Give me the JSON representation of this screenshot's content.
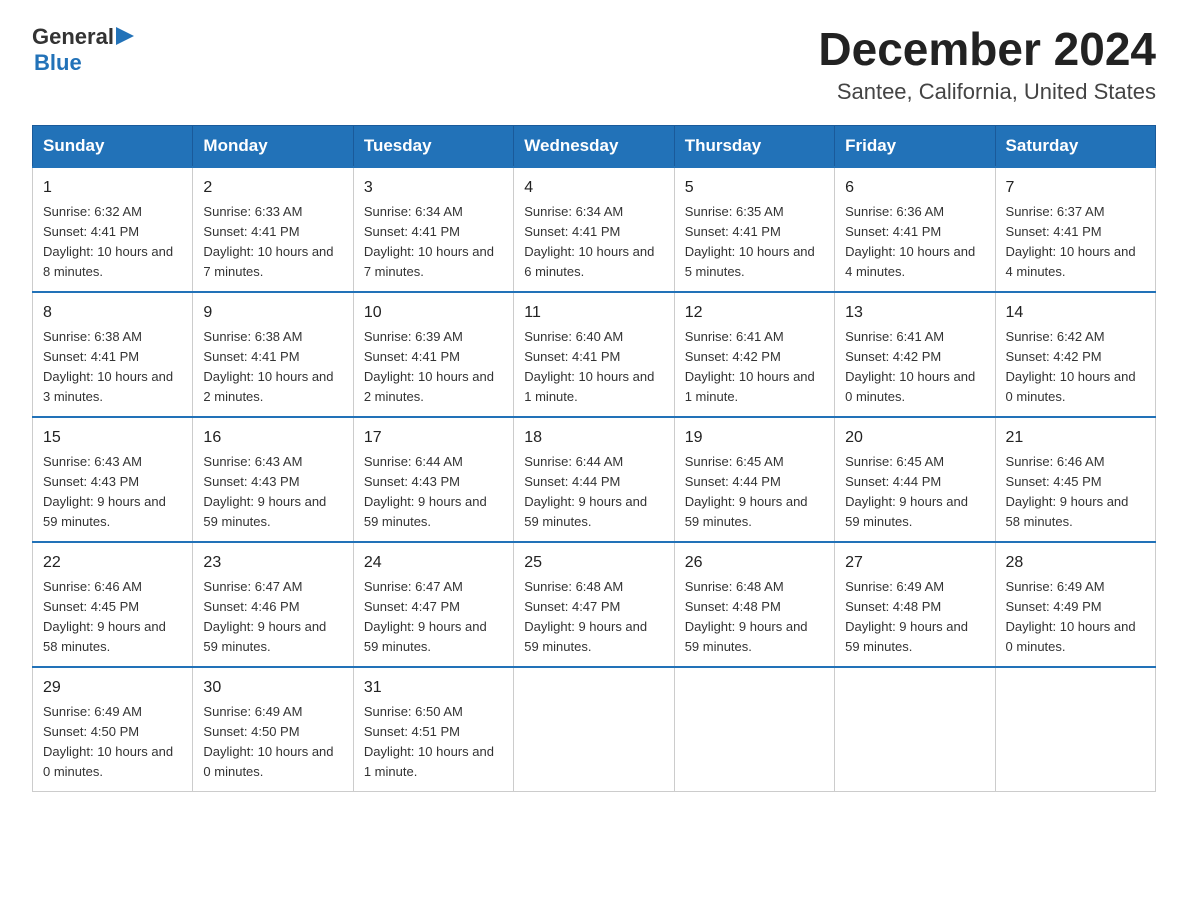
{
  "header": {
    "logo_general": "General",
    "logo_blue": "Blue",
    "title": "December 2024",
    "subtitle": "Santee, California, United States"
  },
  "days_of_week": [
    "Sunday",
    "Monday",
    "Tuesday",
    "Wednesday",
    "Thursday",
    "Friday",
    "Saturday"
  ],
  "weeks": [
    [
      {
        "day": "1",
        "sunrise": "6:32 AM",
        "sunset": "4:41 PM",
        "daylight": "10 hours and 8 minutes."
      },
      {
        "day": "2",
        "sunrise": "6:33 AM",
        "sunset": "4:41 PM",
        "daylight": "10 hours and 7 minutes."
      },
      {
        "day": "3",
        "sunrise": "6:34 AM",
        "sunset": "4:41 PM",
        "daylight": "10 hours and 7 minutes."
      },
      {
        "day": "4",
        "sunrise": "6:34 AM",
        "sunset": "4:41 PM",
        "daylight": "10 hours and 6 minutes."
      },
      {
        "day": "5",
        "sunrise": "6:35 AM",
        "sunset": "4:41 PM",
        "daylight": "10 hours and 5 minutes."
      },
      {
        "day": "6",
        "sunrise": "6:36 AM",
        "sunset": "4:41 PM",
        "daylight": "10 hours and 4 minutes."
      },
      {
        "day": "7",
        "sunrise": "6:37 AM",
        "sunset": "4:41 PM",
        "daylight": "10 hours and 4 minutes."
      }
    ],
    [
      {
        "day": "8",
        "sunrise": "6:38 AM",
        "sunset": "4:41 PM",
        "daylight": "10 hours and 3 minutes."
      },
      {
        "day": "9",
        "sunrise": "6:38 AM",
        "sunset": "4:41 PM",
        "daylight": "10 hours and 2 minutes."
      },
      {
        "day": "10",
        "sunrise": "6:39 AM",
        "sunset": "4:41 PM",
        "daylight": "10 hours and 2 minutes."
      },
      {
        "day": "11",
        "sunrise": "6:40 AM",
        "sunset": "4:41 PM",
        "daylight": "10 hours and 1 minute."
      },
      {
        "day": "12",
        "sunrise": "6:41 AM",
        "sunset": "4:42 PM",
        "daylight": "10 hours and 1 minute."
      },
      {
        "day": "13",
        "sunrise": "6:41 AM",
        "sunset": "4:42 PM",
        "daylight": "10 hours and 0 minutes."
      },
      {
        "day": "14",
        "sunrise": "6:42 AM",
        "sunset": "4:42 PM",
        "daylight": "10 hours and 0 minutes."
      }
    ],
    [
      {
        "day": "15",
        "sunrise": "6:43 AM",
        "sunset": "4:43 PM",
        "daylight": "9 hours and 59 minutes."
      },
      {
        "day": "16",
        "sunrise": "6:43 AM",
        "sunset": "4:43 PM",
        "daylight": "9 hours and 59 minutes."
      },
      {
        "day": "17",
        "sunrise": "6:44 AM",
        "sunset": "4:43 PM",
        "daylight": "9 hours and 59 minutes."
      },
      {
        "day": "18",
        "sunrise": "6:44 AM",
        "sunset": "4:44 PM",
        "daylight": "9 hours and 59 minutes."
      },
      {
        "day": "19",
        "sunrise": "6:45 AM",
        "sunset": "4:44 PM",
        "daylight": "9 hours and 59 minutes."
      },
      {
        "day": "20",
        "sunrise": "6:45 AM",
        "sunset": "4:44 PM",
        "daylight": "9 hours and 59 minutes."
      },
      {
        "day": "21",
        "sunrise": "6:46 AM",
        "sunset": "4:45 PM",
        "daylight": "9 hours and 58 minutes."
      }
    ],
    [
      {
        "day": "22",
        "sunrise": "6:46 AM",
        "sunset": "4:45 PM",
        "daylight": "9 hours and 58 minutes."
      },
      {
        "day": "23",
        "sunrise": "6:47 AM",
        "sunset": "4:46 PM",
        "daylight": "9 hours and 59 minutes."
      },
      {
        "day": "24",
        "sunrise": "6:47 AM",
        "sunset": "4:47 PM",
        "daylight": "9 hours and 59 minutes."
      },
      {
        "day": "25",
        "sunrise": "6:48 AM",
        "sunset": "4:47 PM",
        "daylight": "9 hours and 59 minutes."
      },
      {
        "day": "26",
        "sunrise": "6:48 AM",
        "sunset": "4:48 PM",
        "daylight": "9 hours and 59 minutes."
      },
      {
        "day": "27",
        "sunrise": "6:49 AM",
        "sunset": "4:48 PM",
        "daylight": "9 hours and 59 minutes."
      },
      {
        "day": "28",
        "sunrise": "6:49 AM",
        "sunset": "4:49 PM",
        "daylight": "10 hours and 0 minutes."
      }
    ],
    [
      {
        "day": "29",
        "sunrise": "6:49 AM",
        "sunset": "4:50 PM",
        "daylight": "10 hours and 0 minutes."
      },
      {
        "day": "30",
        "sunrise": "6:49 AM",
        "sunset": "4:50 PM",
        "daylight": "10 hours and 0 minutes."
      },
      {
        "day": "31",
        "sunrise": "6:50 AM",
        "sunset": "4:51 PM",
        "daylight": "10 hours and 1 minute."
      },
      null,
      null,
      null,
      null
    ]
  ]
}
